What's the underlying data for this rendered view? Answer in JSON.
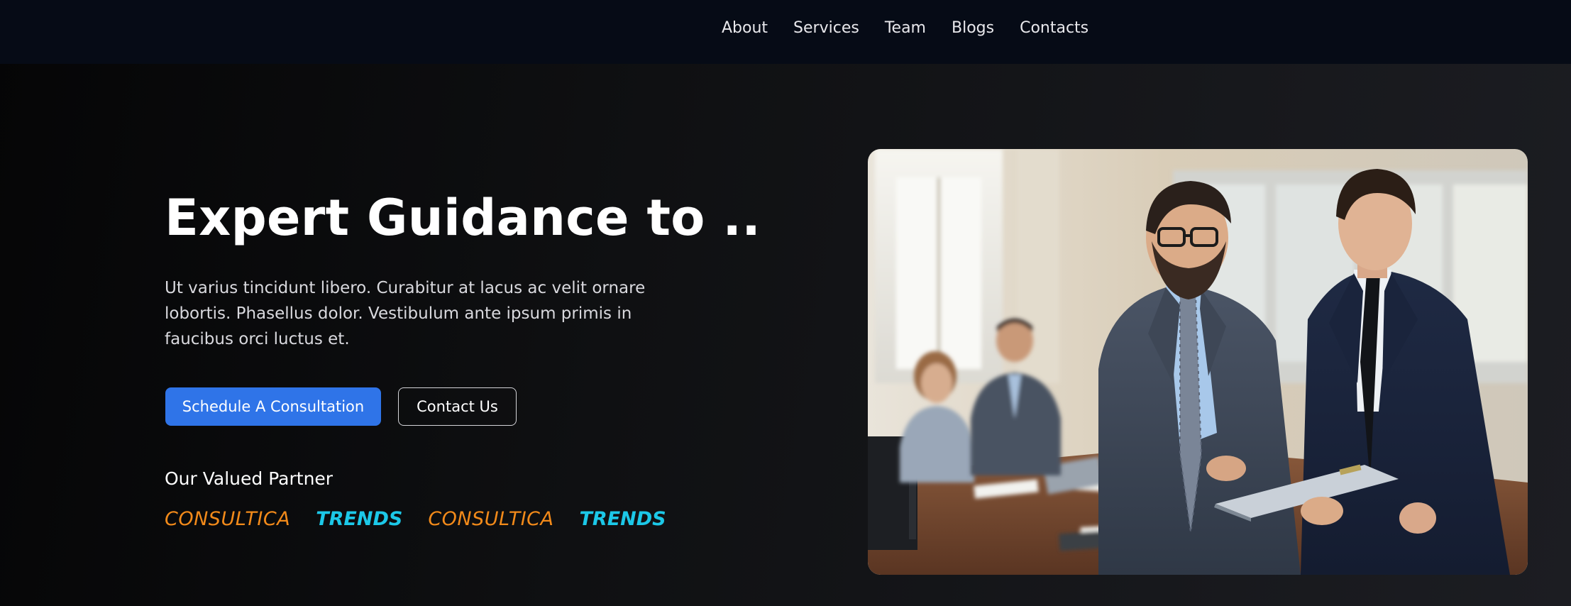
{
  "nav": {
    "items": [
      "About",
      "Services",
      "Team",
      "Blogs",
      "Contacts"
    ]
  },
  "hero": {
    "title": "Expert Guidance to ..",
    "subtitle": "Ut varius tincidunt libero. Curabitur at lacus ac velit ornare lobortis. Phasellus dolor. Vestibulum ante ipsum primis in faucibus orci luctus et.",
    "primary_button": "Schedule A Consultation",
    "secondary_button": "Contact Us"
  },
  "partners": {
    "heading": "Our Valued Partner",
    "logos": [
      "CONSULTICA",
      "TRENDS",
      "CONSULTICA",
      "TRENDS"
    ]
  },
  "colors": {
    "nav_background": "#060b16",
    "primary_button": "#2f74e8",
    "partner_orange": "#f28a1a",
    "partner_cyan": "#1cc8e8"
  },
  "image": {
    "subject": "business-meeting-photo"
  }
}
